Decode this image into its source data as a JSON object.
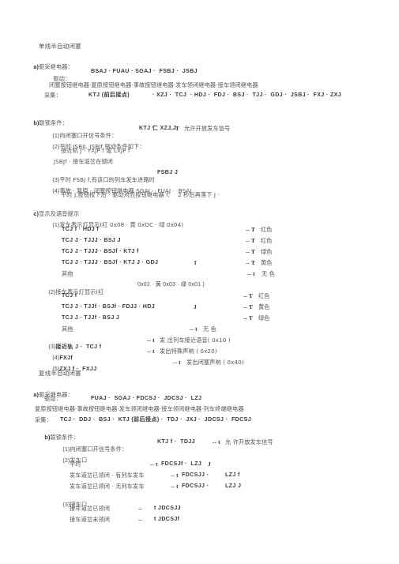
{
  "document": {
    "type": "scanned-technical-document",
    "language": "zh-CN",
    "background_color": "#ffffff",
    "text_color": "#4a4a4a"
  },
  "section_one": {
    "title": "单线半自动闭塞",
    "part_a": {
      "label": "a)",
      "heading": "驱采继电器：",
      "drive_label": "驱动：",
      "drive_values": "BSAJ · FUAU · SGAJ ·  FSBJ ·  JSBJ",
      "drive_note": "闭塞按钮继电器·复原按钮继电器·事故按钮继电器·发车领闭继电器·接车领闭继电器",
      "collect_label": "采集：",
      "collect_values": "KTJ (前后接点)",
      "collect_values_2": "· XZJ ·  TCJ  · HDJ ·  FDJ ·  BSJ ·  TJJ ·  GDJ ·  JSBJ ·  FXJ · ZXJ"
    },
    "part_b": {
      "label": "b)",
      "heading": "联锁条件：",
      "items": [
        {
          "num": "(1)",
          "text": "向闭塞口开信号条件：",
          "expr": "KTJ 仁 XZJ J",
          "arrow": "-- T",
          "result": "允许开放发车信号"
        },
        {
          "num": "(2)",
          "text": "平时 JSBJj. JSBJf 驱动条件如下：",
          "sub": [
            {
              "mark": "i.",
              "text": "接近轨 J · YXJP f 或 LXJP f"
            },
            {
              "mark": "ii.",
              "text": "JSBJf · 接车道岔在锁闭"
            }
          ]
        },
        {
          "num": "(3)",
          "text": "平时 FSBJ f,有该口的列车发车进路时",
          "expr": "FSBJ J"
        },
        {
          "num": "(4)",
          "text": "事故 · 复原 · 闭塞按钮继电器 SGAJ ·  FUAJ ·  BSAJ",
          "sub2": "平时 J,按钮按下后 · 驱动对应按钮继电器 f,",
          "sub2_tail": "2 秒后再落下 J ·"
        }
      ]
    },
    "part_c": {
      "label": "c)",
      "heading": "显示及语音提示",
      "item1": {
        "num": "(1)",
        "text": "发车表示灯显示(红 0x08 · 黄 0xOC · 绿 0x04)",
        "rows": [
          {
            "cond": "TCJ f · HDJ f",
            "extra": "",
            "arrow": "-- T",
            "color": "红色"
          },
          {
            "cond": "TCJ J · TJJJ · BSJ J",
            "extra": "",
            "arrow": "-- T",
            "color": "红色"
          },
          {
            "cond": "TCJ J · TJJJ · BSJf · KTJ f",
            "extra": "",
            "arrow": "-- T",
            "color": "绿色"
          },
          {
            "cond": "TCJ J · TJJJ · BSJf · KTJ J · GDJ",
            "extra": "f",
            "arrow": "-- T",
            "color": "黄色"
          },
          {
            "cond": "其他",
            "extra": "",
            "arrow": "-- t",
            "color": "无 色"
          }
        ]
      },
      "item2": {
        "num": "(2)",
        "text": "接车表示灯显示(红",
        "text_tail": "0x02 · 黄 0x03 · 绿 0x01 )",
        "rows": [
          {
            "cond": "TCJ f",
            "extra": "",
            "arrow": "-- T",
            "color": "红色"
          },
          {
            "cond": "TCJ J · TJJf · BSJf · FDJJ · HDJ",
            "extra": "J",
            "arrow": "-- T",
            "color": "黄色"
          },
          {
            "cond": "TCJ J · TJJf · BSJ J",
            "extra": "",
            "arrow": "-- T",
            "color": "绿色"
          },
          {
            "cond": "其他",
            "extra": "",
            "arrow": "-- t",
            "color": "无 色"
          }
        ]
      },
      "item3": {
        "num": "(3)",
        "text": "接近轨 J ·  TCJ f",
        "arrow": "-- t",
        "result": "发 出列车接近语音( 0x10 )"
      },
      "item4": {
        "num": "(4)",
        "text": "FXJf",
        "arrow": "-- t",
        "result": "发出特殊声响 ( 0x20)"
      },
      "item5": {
        "num": "(5)",
        "text": "ZXJ f ·  FXJJ",
        "arrow": "-- t",
        "result": "发出闭塞声响 ( 0x40)"
      }
    }
  },
  "section_two": {
    "title": "复线半自动闭塞",
    "part_a": {
      "label": "a)",
      "heading": "驱采继电器：",
      "drive_label": "驱动：",
      "drive_values": "FUAJ ·  SGAJ · FDCSJ ·  JDCSJ ·  LZJ",
      "drive_note": "复原按钮继电器·事故按钮继电器·发车领闭继电器·接车领闭继电器·列车终端继电器",
      "collect_label": "采集：",
      "collect_values": "TCJ ·  DDJ ·  BSJ ·  KTJ (前后接点) ·  TDJ ·  JXJ ·  JDCSJ ·  FDCSJ"
    },
    "part_b": {
      "label": "b)",
      "heading": "联锁条件：",
      "item1": {
        "num": "(1)",
        "text": "向闭塞口开信号条件：",
        "expr": "KTJ f ·  TDJJ",
        "arrow": "-- t",
        "result": "允 许开放发车信号"
      },
      "item2": {
        "num": "(2)",
        "text": "发车口",
        "rows": [
          {
            "cond": "平时",
            "arrow": "-- t",
            "expr": "FDCSJf ·  LZJ",
            "expr_tail": "J"
          },
          {
            "cond": "发车道岔已领闭 · 有列车发车",
            "arrow": "-- t",
            "expr": "FDCSJJ ·",
            "expr_tail": "LZJ f"
          },
          {
            "cond": "发车道岔已领闭 · 无列车发车",
            "arrow": "-- t",
            "expr": "FDCSJJ ·",
            "expr_tail": "LZJ J"
          }
        ]
      },
      "item3": {
        "num": "(3)",
        "text": "接车口",
        "rows": [
          {
            "cond": "接车道岔已领闭",
            "arrow": "--",
            "expr": "t JDCSJJ"
          },
          {
            "cond": "接车道岔未领闭",
            "arrow": "--",
            "expr": "t JDCSJf"
          }
        ]
      }
    }
  }
}
